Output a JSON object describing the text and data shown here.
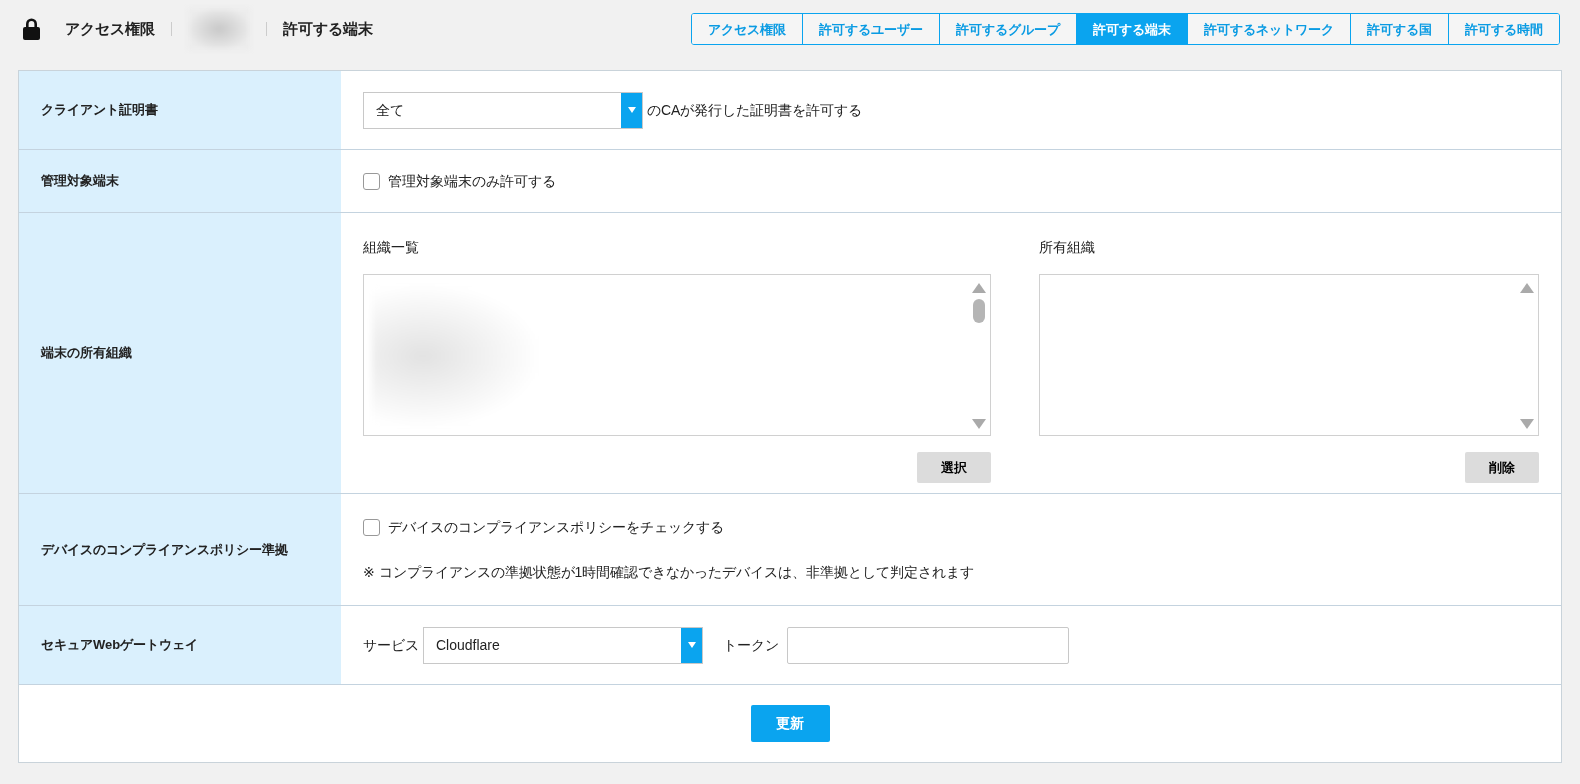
{
  "header": {
    "title": "アクセス権限",
    "current": "許可する端末"
  },
  "tabs": [
    {
      "label": "アクセス権限",
      "selected": false
    },
    {
      "label": "許可するユーザー",
      "selected": false
    },
    {
      "label": "許可するグループ",
      "selected": false
    },
    {
      "label": "許可する端末",
      "selected": true
    },
    {
      "label": "許可するネットワーク",
      "selected": false
    },
    {
      "label": "許可する国",
      "selected": false
    },
    {
      "label": "許可する時間",
      "selected": false
    }
  ],
  "rows": [
    {
      "label": "クライアント証明書",
      "kind": "select",
      "value": "全て",
      "suffix": "のCAが発行した証明書を許可する"
    },
    {
      "label": "管理対象端末",
      "kind": "checkbox",
      "text": "管理対象端末のみ許可する",
      "checked": false
    },
    {
      "label": "端末の所有組織",
      "kind": "lists",
      "lists": [
        {
          "title": "組織一覧",
          "button": "選択",
          "scrollbar": true
        },
        {
          "title": "所有組織",
          "button": "削除",
          "scrollbar": false
        }
      ]
    },
    {
      "label": "デバイスのコンプライアンスポリシー準拠",
      "kind": "checkbox",
      "text": "デバイスのコンプライアンスポリシーをチェックする",
      "checked": false,
      "note": "※ コンプライアンスの準拠状態が1時間確認できなかったデバイスは、非準拠として判定されます"
    },
    {
      "label": "セキュアWebゲートウェイ",
      "kind": "gateway",
      "service_label": "サービス",
      "service": "Cloudflare",
      "token_label": "トークン"
    }
  ],
  "submit": "更新"
}
